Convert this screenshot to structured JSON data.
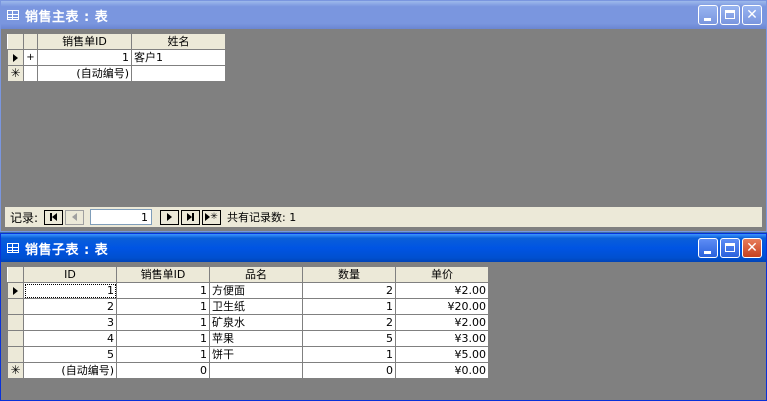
{
  "master_window": {
    "title": "销售主表 : 表",
    "columns": [
      "销售单ID",
      "姓名"
    ],
    "rows": [
      {
        "expander": "+",
        "id": "1",
        "name": "客户1"
      }
    ],
    "new_row": {
      "id": "(自动编号)",
      "name": ""
    },
    "nav": {
      "label": "记录:",
      "current": "1",
      "total_label": "共有记录数: 1"
    }
  },
  "detail_window": {
    "title": "销售子表 : 表",
    "columns": [
      "ID",
      "销售单ID",
      "品名",
      "数量",
      "单价"
    ],
    "rows": [
      {
        "id": "1",
        "order_id": "1",
        "product": "方便面",
        "qty": "2",
        "price": "¥2.00"
      },
      {
        "id": "2",
        "order_id": "1",
        "product": "卫生纸",
        "qty": "1",
        "price": "¥20.00"
      },
      {
        "id": "3",
        "order_id": "1",
        "product": "矿泉水",
        "qty": "2",
        "price": "¥2.00"
      },
      {
        "id": "4",
        "order_id": "1",
        "product": "苹果",
        "qty": "5",
        "price": "¥3.00"
      },
      {
        "id": "5",
        "order_id": "1",
        "product": "饼干",
        "qty": "1",
        "price": "¥5.00"
      }
    ],
    "new_row": {
      "id": "(自动编号)",
      "order_id": "0",
      "product": "",
      "qty": "0",
      "price": "¥0.00"
    }
  },
  "icons": {
    "minimize": "minimize-icon",
    "maximize": "maximize-icon",
    "close": "close-icon",
    "table": "table-icon",
    "current_row": "current-row-arrow-icon",
    "new_row": "new-row-asterisk-icon"
  },
  "colors": {
    "active_title": "#0054e3",
    "inactive_title": "#7a96df",
    "workspace": "#808080",
    "chrome": "#ece9d8"
  }
}
